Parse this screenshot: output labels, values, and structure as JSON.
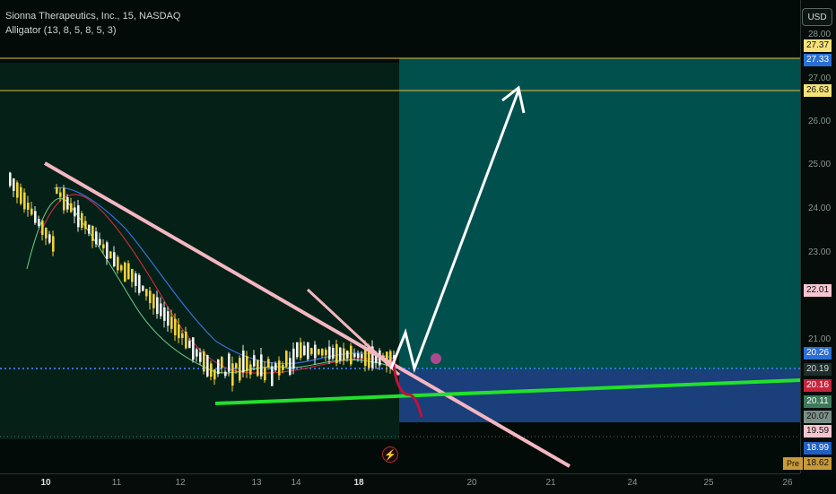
{
  "legend": {
    "symbol_line": "Sionna Therapeutics, Inc., 15, NASDAQ",
    "indicator_line": "Alligator (13, 8, 5, 8, 5, 3)"
  },
  "currency_button": "USD",
  "price_axis_labels": [
    "28.00",
    "27.00",
    "26.00",
    "25.00",
    "24.00",
    "23.00",
    "21.00"
  ],
  "price_tags": [
    {
      "text": "27.37",
      "bg": "#f6e27a",
      "fg": "#111111"
    },
    {
      "text": "27.33",
      "bg": "#2a6fd6",
      "fg": "#ffffff"
    },
    {
      "text": "26.63",
      "bg": "#f6e27a",
      "fg": "#111111"
    },
    {
      "text": "22.01",
      "bg": "#f5c6cf",
      "fg": "#111111"
    },
    {
      "text": "20.26",
      "bg": "#2a6fd6",
      "fg": "#ffffff"
    },
    {
      "text": "20.19",
      "bg": "#1f2e2a",
      "fg": "#d0d8d4"
    },
    {
      "text": "20.16",
      "bg": "#c8243c",
      "fg": "#ffffff"
    },
    {
      "text": "20.11",
      "bg": "#3c7a5a",
      "fg": "#ffffff"
    },
    {
      "text": "20.07",
      "bg": "#7b8f86",
      "fg": "#111111"
    },
    {
      "text": "19.59",
      "bg": "#f5c6cf",
      "fg": "#111111"
    },
    {
      "text": "18.99",
      "bg": "#1f5fc2",
      "fg": "#ffffff"
    },
    {
      "text": "18.62",
      "bg": "#c89a3a",
      "fg": "#111111"
    }
  ],
  "pre_tag": "Pre",
  "time_axis_labels": [
    "10",
    "11",
    "12",
    "13",
    "14",
    "18",
    "20",
    "21",
    "24",
    "25",
    "26"
  ],
  "colors": {
    "background": "#030b08",
    "target_zone": "#00504e",
    "stop_zone": "#1a3f7a",
    "green_line": "#22e02c",
    "pink_line": "#f4b6c2",
    "yellow_line": "#e8c03c",
    "blue_dotted": "#3a6ee8",
    "arrow": "#ffffff"
  },
  "chart_data": {
    "type": "candlestick",
    "series": [
      {
        "name": "Jaw"
      },
      {
        "name": "Teeth"
      },
      {
        "name": "Lips"
      }
    ],
    "levels": [
      27.37,
      26.63,
      20.26,
      19.59
    ],
    "ylim": [
      18.62,
      28.0
    ]
  }
}
